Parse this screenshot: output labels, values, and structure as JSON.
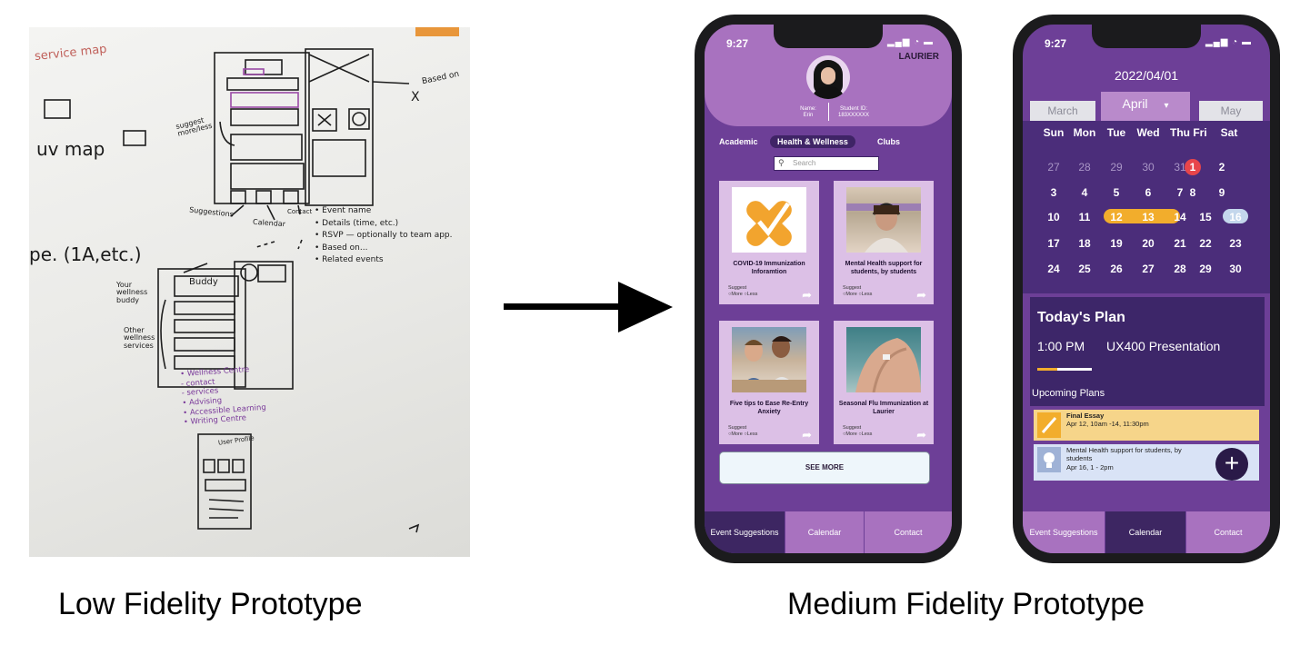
{
  "captions": {
    "low": "Low Fidelity Prototype",
    "medium": "Medium Fidelity Prototype"
  },
  "sketch": {
    "labels": {
      "service_map": "service map",
      "uv_map": "uv map",
      "type": "pe. (1A,etc.)",
      "based_on": "Based on",
      "x": "X",
      "suggest": "suggest more/less",
      "suggestions": "Suggestions",
      "calendar": "Calendar",
      "contact": "Contact",
      "your_wellness": "Your wellness buddy",
      "buddy": "Buddy",
      "other_wellness": "Other wellness services",
      "event_list": [
        "• Event name",
        "• Details (time, etc.)",
        "• RSVP — optionally to team app.",
        "• Based on...",
        "• Related events"
      ],
      "services_list": [
        "• Wellness Centre",
        "  - contact",
        "  - services",
        "• Advising",
        "• Accessible Learning",
        "• Writing Centre"
      ],
      "user_profile": "User Profile"
    }
  },
  "phone1": {
    "time": "9:27",
    "status_icons": "▂▄▆ ◔ ▬",
    "brand": "LAURIER",
    "name_label": "Name:",
    "name_value": "Erin",
    "student_label": "Student ID:",
    "student_value": "183XXXXXX",
    "tabs": [
      "Academic",
      "Health & Wellness",
      "Clubs"
    ],
    "search_placeholder": "Search",
    "cards": [
      {
        "title": "COVID-19 Immunization Inforamtion",
        "suggest": "Suggest",
        "options": "○More  ○Less"
      },
      {
        "title": "Mental Health support for students, by students",
        "suggest": "Suggest",
        "options": "○More  ○Less"
      },
      {
        "title": "Five tips to Ease Re-Entry Anxiety",
        "suggest": "Suggest",
        "options": "○More  ○Less"
      },
      {
        "title": "Seasonal Flu Immunization at Laurier",
        "suggest": "Suggest",
        "options": "○More  ○Less"
      }
    ],
    "see_more": "SEE MORE",
    "nav": [
      "Event Suggestions",
      "Calendar",
      "Contact"
    ]
  },
  "phone2": {
    "time": "9:27",
    "status_icons": "▂▄▆ ◔ ▬",
    "date": "2022/04/01",
    "months": {
      "prev": "March",
      "current": "April",
      "next": "May"
    },
    "dropdown_icon": "▾",
    "weekdays": [
      "Sun",
      "Mon",
      "Tue",
      "Wed",
      "Thu",
      "Fri",
      "Sat"
    ],
    "weeks": [
      [
        "27",
        "28",
        "29",
        "30",
        "31",
        "1",
        "2"
      ],
      [
        "3",
        "4",
        "5",
        "6",
        "7",
        "8",
        "9"
      ],
      [
        "10",
        "11",
        "12",
        "13",
        "14",
        "15",
        "16"
      ],
      [
        "17",
        "18",
        "19",
        "20",
        "21",
        "22",
        "23"
      ],
      [
        "24",
        "25",
        "26",
        "27",
        "28",
        "29",
        "30"
      ]
    ],
    "todays_plan_title": "Today's Plan",
    "plan_time": "1:00 PM",
    "plan_name": "UX400 Presentation",
    "upcoming_label": "Upcoming Plans",
    "upcoming": [
      {
        "title": "Final Essay",
        "detail": "Apr 12, 10am -14, 11:30pm"
      },
      {
        "title": "Mental Health support for students, by students",
        "detail": "Apr 16, 1 - 2pm"
      }
    ],
    "fab": "+",
    "nav": [
      "Event Suggestions",
      "Calendar",
      "Contact"
    ]
  },
  "colors": {
    "purple_dark": "#4b2d7a",
    "purple_mid": "#6d3f97",
    "purple_light": "#a872bf",
    "card_lilac": "#dcc0e6",
    "highlight_orange": "#f2ad2c",
    "today_red": "#e8454a",
    "selected_blue": "#c4d7ec"
  }
}
